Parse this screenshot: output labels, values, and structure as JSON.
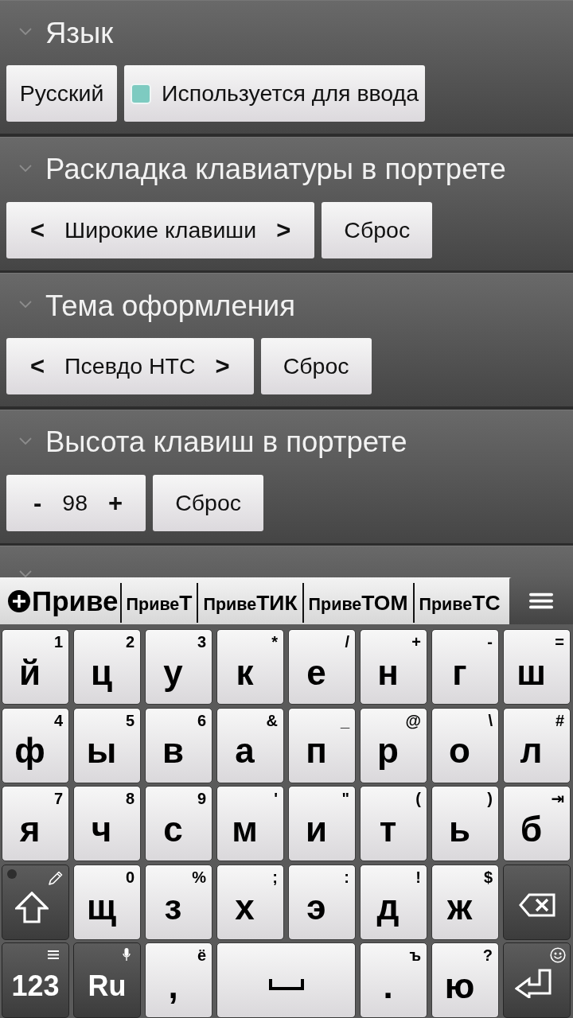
{
  "settings": [
    {
      "title": "Язык",
      "controls": [
        {
          "kind": "button",
          "label": "Русский"
        },
        {
          "kind": "checkbox",
          "label": "Используется для ввода",
          "checked": true
        }
      ]
    },
    {
      "title": "Раскладка клавиатуры в портрете",
      "controls": [
        {
          "kind": "selector",
          "prev": "<",
          "value": "Широкие клавиши",
          "next": ">"
        },
        {
          "kind": "button",
          "label": "Сброс"
        }
      ]
    },
    {
      "title": "Тема оформления",
      "controls": [
        {
          "kind": "selector",
          "prev": "<",
          "value": "Псевдо HTC",
          "next": ">"
        },
        {
          "kind": "button",
          "label": "Сброс"
        }
      ]
    },
    {
      "title": "Высота клавиш в портрете",
      "controls": [
        {
          "kind": "stepper",
          "prev": "-",
          "value": "98",
          "next": "+"
        },
        {
          "kind": "button",
          "label": "Сброс"
        }
      ]
    }
  ],
  "keyboard": {
    "suggestions": [
      {
        "kind": "typed",
        "text": "Приве"
      },
      {
        "kind": "completion",
        "text": "Приве**Т**"
      },
      {
        "kind": "completion",
        "text": "Приве**ТИК**"
      },
      {
        "kind": "completion",
        "text": "Приве**ТОМ**"
      },
      {
        "kind": "completion",
        "text": "Приве**ТС**"
      }
    ],
    "rows": [
      {
        "keys": [
          {
            "kind": "char",
            "label": "й",
            "hint": "1"
          },
          {
            "kind": "char",
            "label": "ц",
            "hint": "2"
          },
          {
            "kind": "char",
            "label": "у",
            "hint": "3"
          },
          {
            "kind": "char",
            "label": "к",
            "hint": "*"
          },
          {
            "kind": "char",
            "label": "е",
            "hint": "/"
          },
          {
            "kind": "char",
            "label": "н",
            "hint": "+"
          },
          {
            "kind": "char",
            "label": "г",
            "hint": "-"
          },
          {
            "kind": "char",
            "label": "ш",
            "hint": "="
          }
        ]
      },
      {
        "keys": [
          {
            "kind": "char",
            "label": "ф",
            "hint": "4"
          },
          {
            "kind": "char",
            "label": "ы",
            "hint": "5"
          },
          {
            "kind": "char",
            "label": "в",
            "hint": "6"
          },
          {
            "kind": "char",
            "label": "а",
            "hint": "&"
          },
          {
            "kind": "char",
            "label": "п",
            "hint": "_"
          },
          {
            "kind": "char",
            "label": "р",
            "hint": "@"
          },
          {
            "kind": "char",
            "label": "о",
            "hint": "\\"
          },
          {
            "kind": "char",
            "label": "л",
            "hint": "#"
          }
        ]
      },
      {
        "keys": [
          {
            "kind": "char",
            "label": "я",
            "hint": "7"
          },
          {
            "kind": "char",
            "label": "ч",
            "hint": "8"
          },
          {
            "kind": "char",
            "label": "с",
            "hint": "9"
          },
          {
            "kind": "char",
            "label": "м",
            "hint": "'"
          },
          {
            "kind": "char",
            "label": "и",
            "hint": "\""
          },
          {
            "kind": "char",
            "label": "т",
            "hint": "("
          },
          {
            "kind": "char",
            "label": "ь",
            "hint": ")"
          },
          {
            "kind": "char",
            "label": "б",
            "hint": "⇥"
          }
        ]
      },
      {
        "keys": [
          {
            "kind": "shift"
          },
          {
            "kind": "char",
            "label": "щ",
            "hint": "0"
          },
          {
            "kind": "char",
            "label": "з",
            "hint": "%"
          },
          {
            "kind": "char",
            "label": "х",
            "hint": ";"
          },
          {
            "kind": "char",
            "label": "э",
            "hint": ":"
          },
          {
            "kind": "char",
            "label": "д",
            "hint": "!"
          },
          {
            "kind": "char",
            "label": "ж",
            "hint": "$"
          },
          {
            "kind": "backspace"
          }
        ]
      },
      {
        "keys": [
          {
            "kind": "mode",
            "label": "123"
          },
          {
            "kind": "lang",
            "label": "Ru"
          },
          {
            "kind": "char",
            "label": ",",
            "hint": "ё"
          },
          {
            "kind": "space"
          },
          {
            "kind": "char",
            "label": ".",
            "hint": "ъ"
          },
          {
            "kind": "char",
            "label": "ю",
            "hint": "?"
          },
          {
            "kind": "enter"
          }
        ]
      }
    ]
  }
}
